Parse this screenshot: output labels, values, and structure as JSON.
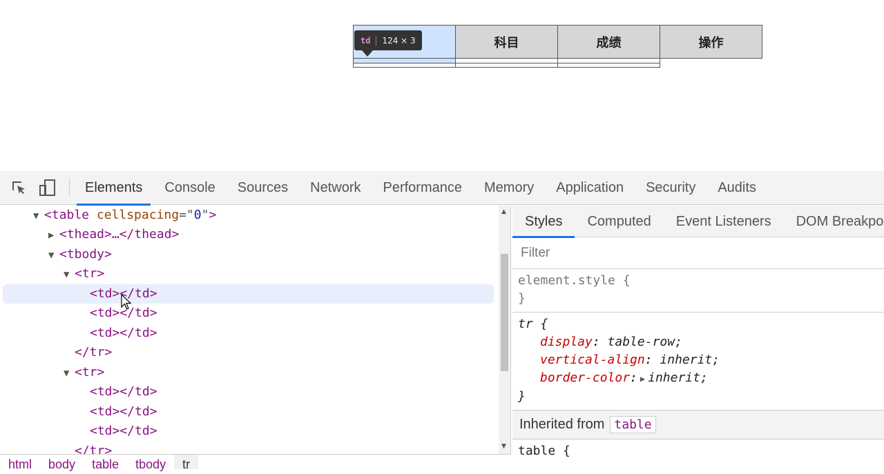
{
  "preview": {
    "headers": [
      "",
      "科目",
      "成绩",
      "操作"
    ],
    "tooltip": {
      "tag": "td",
      "dims": "124 × 3"
    }
  },
  "toolbar": {
    "tabs": [
      "Elements",
      "Console",
      "Sources",
      "Network",
      "Performance",
      "Memory",
      "Application",
      "Security",
      "Audits"
    ],
    "active_tab": "Elements"
  },
  "dom": {
    "lines": [
      {
        "tri": "▼",
        "html": "table_open"
      },
      {
        "tri": "▶",
        "html": "thead"
      },
      {
        "tri": "▼",
        "html": "tbody"
      },
      {
        "tri": "▼",
        "html": "tr"
      },
      {
        "html": "td"
      },
      {
        "html": "td"
      },
      {
        "html": "td"
      },
      {
        "html": "tr_close"
      },
      {
        "tri": "▼",
        "html": "tr"
      },
      {
        "html": "td"
      },
      {
        "html": "td"
      },
      {
        "html": "td"
      },
      {
        "html": "tr_close"
      }
    ],
    "table_attr_name": "cellspacing",
    "table_attr_value": "0",
    "thead_text": "<thead>…</thead>",
    "tbody_text": "<tbody>",
    "tr_text": "<tr>",
    "td_text": "<td></td>",
    "tr_close_text": "</tr>",
    "table_open_prefix": "<table",
    "table_open_suffix": ">"
  },
  "breadcrumbs": [
    "html",
    "body",
    "table",
    "tbody",
    "tr"
  ],
  "styles": {
    "tabs": [
      "Styles",
      "Computed",
      "Event Listeners",
      "DOM Breakpoints"
    ],
    "filter_placeholder": "Filter",
    "element_style_selector": "element.style {",
    "close_brace": "}",
    "tr_rule": {
      "selector": "tr {",
      "decls": [
        {
          "prop": "display",
          "value": "table-row;"
        },
        {
          "prop": "vertical-align",
          "value": "inherit;"
        },
        {
          "prop": "border-color",
          "value": "inherit;"
        }
      ]
    },
    "inherited_label": "Inherited from",
    "inherited_tag": "table",
    "table_rule_selector": "table {"
  },
  "colors": {
    "accent": "#1a73e8",
    "tag": "#881280",
    "attr": "#994500",
    "attrval": "#1a1aa6",
    "prop": "#c80000"
  }
}
